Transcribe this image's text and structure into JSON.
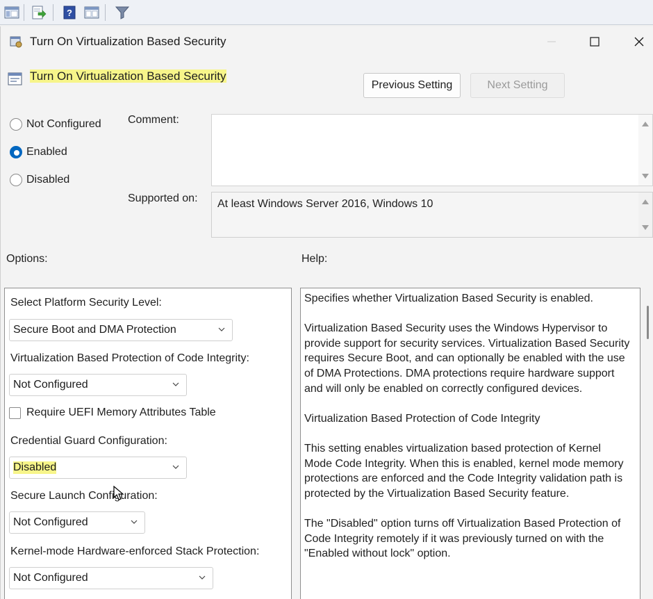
{
  "toolbar": {
    "icons": [
      "console-view-icon",
      "export-list-icon",
      "help-icon",
      "properties-icon",
      "filter-icon"
    ]
  },
  "dialog": {
    "window_title": "Turn On Virtualization Based Security",
    "setting_name": "Turn On Virtualization Based Security",
    "prev_button": "Previous Setting",
    "next_button": "Next Setting",
    "state": {
      "options": [
        "Not Configured",
        "Enabled",
        "Disabled"
      ],
      "selected": "Enabled"
    },
    "comment_label": "Comment:",
    "comment_value": "",
    "supported_label": "Supported on:",
    "supported_value": "At least Windows Server 2016, Windows 10",
    "options_label": "Options:",
    "help_label": "Help:"
  },
  "options": {
    "platform_label": "Select Platform Security Level:",
    "platform_value": "Secure Boot and DMA Protection",
    "code_integrity_label": "Virtualization Based Protection of Code Integrity:",
    "code_integrity_value": "Not Configured",
    "uefi_checkbox_label": "Require UEFI Memory Attributes Table",
    "uefi_checked": false,
    "cred_guard_label": "Credential Guard Configuration:",
    "cred_guard_value": "Disabled",
    "secure_launch_label": "Secure Launch Configuration:",
    "secure_launch_value": "Not Configured",
    "stack_protection_label": "Kernel-mode Hardware-enforced Stack Protection:",
    "stack_protection_value": "Not Configured"
  },
  "help": {
    "paragraphs": [
      "Specifies whether Virtualization Based Security is enabled.",
      "Virtualization Based Security uses the Windows Hypervisor to provide support for security services. Virtualization Based Security requires Secure Boot, and can optionally be enabled with the use of DMA Protections. DMA protections require hardware support and will only be enabled on correctly configured devices.",
      "Virtualization Based Protection of Code Integrity",
      "This setting enables virtualization based protection of Kernel Mode Code Integrity. When this is enabled, kernel mode memory protections are enforced and the Code Integrity validation path is protected by the Virtualization Based Security feature.",
      "The \"Disabled\" option turns off Virtualization Based Protection of Code Integrity remotely if it was previously turned on with the \"Enabled without lock\" option."
    ]
  },
  "colors": {
    "highlight": "#f7f58a",
    "accent": "#0067c0"
  }
}
